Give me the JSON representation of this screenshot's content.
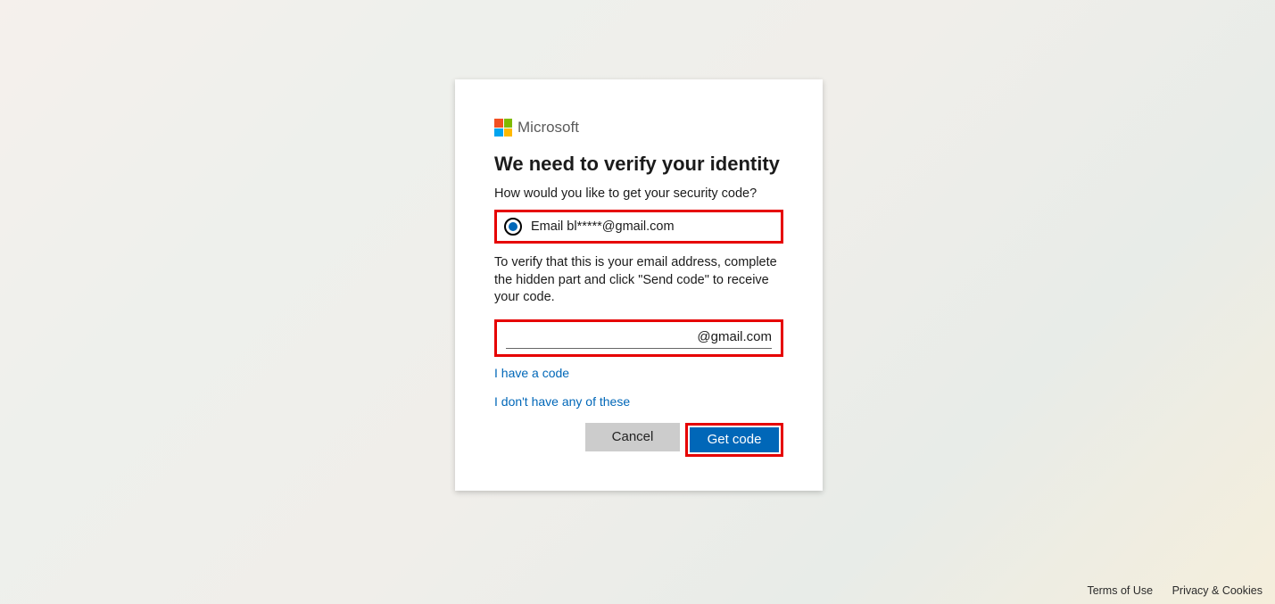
{
  "brand": "Microsoft",
  "heading": "We need to verify your identity",
  "subtext": "How would you like to get your security code?",
  "radio": {
    "label": "Email bl*****@gmail.com"
  },
  "instruction": "To verify that this is your email address, complete the hidden part and click \"Send code\" to receive your code.",
  "input": {
    "value": "",
    "suffix": "@gmail.com"
  },
  "links": {
    "have_code": "I have a code",
    "none": "I don't have any of these"
  },
  "buttons": {
    "cancel": "Cancel",
    "primary": "Get code"
  },
  "footer": {
    "terms": "Terms of Use",
    "privacy": "Privacy & Cookies"
  }
}
